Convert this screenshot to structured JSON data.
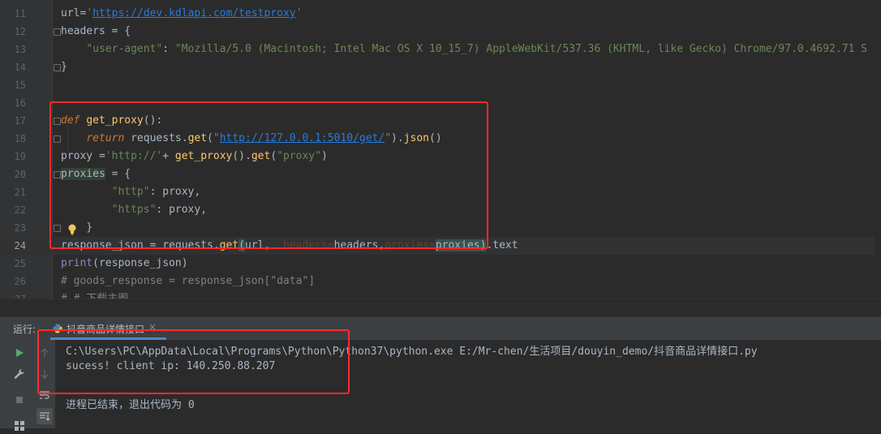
{
  "editor": {
    "lines": [
      {
        "num": "11",
        "segments": [
          {
            "t": "url",
            "c": ""
          },
          {
            "t": "=",
            "c": ""
          },
          {
            "t": "'",
            "c": "str"
          },
          {
            "t": "https://dev.kdlapi.com/testproxy",
            "c": "url"
          },
          {
            "t": "'",
            "c": "str"
          }
        ]
      },
      {
        "num": "12",
        "segments": [
          {
            "t": "headers",
            "c": ""
          },
          {
            "t": " = {",
            "c": ""
          }
        ]
      },
      {
        "num": "13",
        "segments": [
          {
            "t": "    ",
            "c": ""
          },
          {
            "t": "\"user-agent\"",
            "c": "str"
          },
          {
            "t": ": ",
            "c": ""
          },
          {
            "t": "\"Mozilla/5.0 (Macintosh; Intel Mac OS X 10_15_7) AppleWebKit/537.36 (KHTML, like Gecko) Chrome/97.0.4692.71 S",
            "c": "str"
          }
        ]
      },
      {
        "num": "14",
        "segments": [
          {
            "t": "}",
            "c": ""
          }
        ]
      },
      {
        "num": "15",
        "segments": []
      },
      {
        "num": "16",
        "segments": []
      },
      {
        "num": "17",
        "segments": [
          {
            "t": "def",
            "c": "kwi"
          },
          {
            "t": " ",
            "c": ""
          },
          {
            "t": "get_proxy",
            "c": "fn"
          },
          {
            "t": "():",
            "c": ""
          }
        ]
      },
      {
        "num": "18",
        "segments": [
          {
            "t": "    ",
            "c": ""
          },
          {
            "t": "return",
            "c": "kwi"
          },
          {
            "t": " requests.",
            "c": ""
          },
          {
            "t": "get",
            "c": "fn"
          },
          {
            "t": "(",
            "c": ""
          },
          {
            "t": "\"",
            "c": "str"
          },
          {
            "t": "http://127.0.0.1:5010/get/",
            "c": "url"
          },
          {
            "t": "\"",
            "c": "str"
          },
          {
            "t": ").",
            "c": ""
          },
          {
            "t": "json",
            "c": "fn"
          },
          {
            "t": "()",
            "c": ""
          }
        ]
      },
      {
        "num": "19",
        "segments": [
          {
            "t": "proxy",
            "c": ""
          },
          {
            "t": " =",
            "c": ""
          },
          {
            "t": "'http://'",
            "c": "str"
          },
          {
            "t": "+ ",
            "c": ""
          },
          {
            "t": "get_proxy",
            "c": "fn"
          },
          {
            "t": "().",
            "c": ""
          },
          {
            "t": "get",
            "c": "fn"
          },
          {
            "t": "(",
            "c": ""
          },
          {
            "t": "\"proxy\"",
            "c": "str"
          },
          {
            "t": ")",
            "c": ""
          }
        ]
      },
      {
        "num": "20",
        "segments": [
          {
            "t": "proxies",
            "c": "var-hl"
          },
          {
            "t": " = {",
            "c": ""
          }
        ]
      },
      {
        "num": "21",
        "segments": [
          {
            "t": "        ",
            "c": ""
          },
          {
            "t": "\"http\"",
            "c": "str"
          },
          {
            "t": ": proxy,",
            "c": ""
          }
        ]
      },
      {
        "num": "22",
        "segments": [
          {
            "t": "        ",
            "c": ""
          },
          {
            "t": "\"https\"",
            "c": "str"
          },
          {
            "t": ": proxy,",
            "c": ""
          }
        ]
      },
      {
        "num": "23",
        "segments": [
          {
            "t": "    }",
            "c": ""
          }
        ]
      },
      {
        "num": "24",
        "segments": [
          {
            "t": "response_json",
            "c": ""
          },
          {
            "t": " = requests.",
            "c": ""
          },
          {
            "t": "get",
            "c": "fn"
          },
          {
            "t": "(",
            "c": "paren-match"
          },
          {
            "t": "url, ",
            "c": ""
          },
          {
            "t": " headers=",
            "c": "param"
          },
          {
            "t": "headers,",
            "c": ""
          },
          {
            "t": "proxies=",
            "c": "param"
          },
          {
            "t": "proxies",
            "c": "var-hl2"
          },
          {
            "t": ")",
            "c": "paren-match"
          },
          {
            "t": ".text",
            "c": ""
          }
        ]
      },
      {
        "num": "25",
        "segments": [
          {
            "t": "print",
            "c": "bi"
          },
          {
            "t": "(response_json)",
            "c": ""
          }
        ]
      },
      {
        "num": "26",
        "segments": [
          {
            "t": "# goods_response = response_json[\"data\"]",
            "c": "cmt"
          }
        ]
      },
      {
        "num": "27",
        "segments": [
          {
            "t": "# # 下载主图",
            "c": "cmt"
          }
        ]
      }
    ]
  },
  "run_panel": {
    "label": "运行:",
    "tab_name": "抖音商品详情接口",
    "tab_close": "×",
    "console_lines": [
      "C:\\Users\\PC\\AppData\\Local\\Programs\\Python\\Python37\\python.exe E:/Mr-chen/生活项目/douyin_demo/抖音商品详情接口.py",
      "sucess! client ip: 140.250.88.207",
      "",
      "进程已结束，退出代码为 0"
    ]
  },
  "colors": {
    "annotation": "#ff2a2a",
    "run_green": "#59a869",
    "tab_underline": "#4a88c7"
  }
}
